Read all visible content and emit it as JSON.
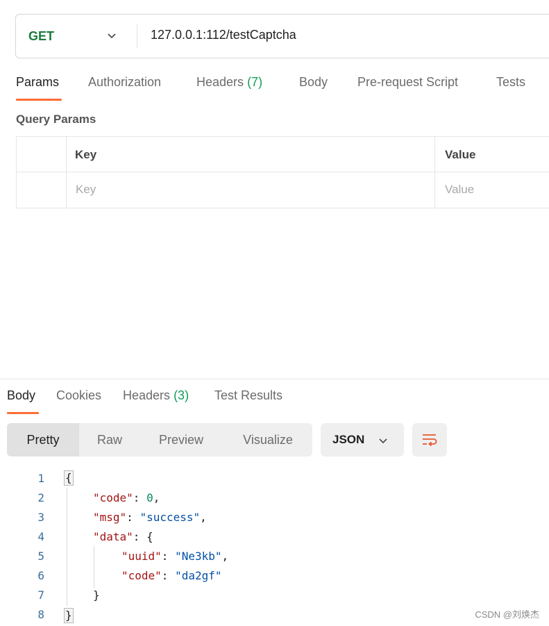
{
  "request": {
    "method": "GET",
    "url": "127.0.0.1:112/testCaptcha"
  },
  "request_tabs": {
    "params": "Params",
    "authorization": "Authorization",
    "headers": "Headers",
    "headers_count": "(7)",
    "body": "Body",
    "pre_request": "Pre-request Script",
    "tests": "Tests"
  },
  "query_params": {
    "title": "Query Params",
    "columns": {
      "key": "Key",
      "value": "Value"
    },
    "placeholders": {
      "key": "Key",
      "value": "Value"
    }
  },
  "response_tabs": {
    "body": "Body",
    "cookies": "Cookies",
    "headers": "Headers",
    "headers_count": "(3)",
    "test_results": "Test Results"
  },
  "view_modes": {
    "pretty": "Pretty",
    "raw": "Raw",
    "preview": "Preview",
    "visualize": "Visualize",
    "selected": "Pretty"
  },
  "format": {
    "selected": "JSON"
  },
  "code": {
    "line_numbers": [
      "1",
      "2",
      "3",
      "4",
      "5",
      "6",
      "7",
      "8"
    ],
    "open_brace": "{",
    "close_brace": "}",
    "code_key": "\"code\"",
    "code_value": "0",
    "msg_key": "\"msg\"",
    "msg_value": "\"success\"",
    "data_key": "\"data\"",
    "data_open": "{",
    "uuid_key": "\"uuid\"",
    "uuid_value": "\"Ne3kb\"",
    "inner_code_key": "\"code\"",
    "inner_code_value": "\"da2gf\"",
    "data_close": "}"
  },
  "watermark": "CSDN @刘焕杰",
  "colors": {
    "accent": "#ff6c37",
    "method_get": "#1d7a3c",
    "count": "#0f9d58",
    "json_key": "#a31515",
    "json_string": "#0451a5",
    "json_number": "#098658"
  }
}
